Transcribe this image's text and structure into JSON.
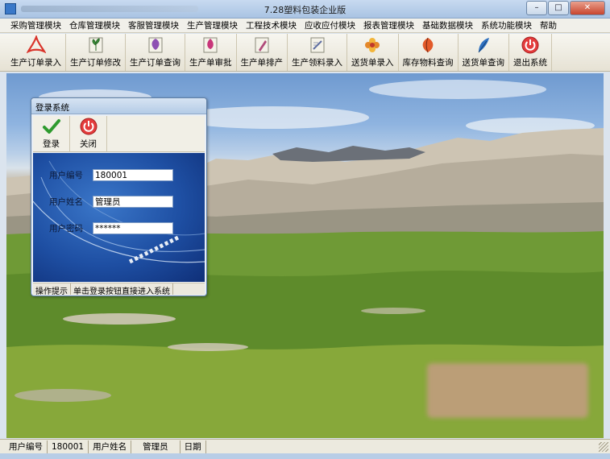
{
  "window": {
    "title": "7.28塑料包装企业版",
    "minimize": "–",
    "maximize": "□",
    "close": "✕"
  },
  "menu": [
    "采购管理模块",
    "仓库管理模块",
    "客服管理模块",
    "生产管理模块",
    "工程技术模块",
    "应收应付模块",
    "报表管理模块",
    "基础数据模块",
    "系统功能模块",
    "帮助"
  ],
  "toolbar": [
    {
      "label": "生产订单录入",
      "icon": "acrobat-icon",
      "color": "#d9342b"
    },
    {
      "label": "生产订单修改",
      "icon": "plant-icon",
      "color": "#3c8e3a"
    },
    {
      "label": "生产订单查询",
      "icon": "purple-flower-icon",
      "color": "#8e4fb3"
    },
    {
      "label": "生产单审批",
      "icon": "pink-flower-icon",
      "color": "#c8367a"
    },
    {
      "label": "生产单排产",
      "icon": "pen-icon",
      "color": "#b04b7a"
    },
    {
      "label": "生产领料录入",
      "icon": "document-pen-icon",
      "color": "#5f6fa3"
    },
    {
      "label": "送货单录入",
      "icon": "flower-icon",
      "color": "#e4882a"
    },
    {
      "label": "库存物料查询",
      "icon": "orange-flower-icon",
      "color": "#e25a2a"
    },
    {
      "label": "送货单查询",
      "icon": "blue-feather-icon",
      "color": "#2f71c0"
    },
    {
      "label": "退出系统",
      "icon": "exit-icon",
      "color": "#e33b3b"
    }
  ],
  "dialog": {
    "title": "登录系统",
    "login_label": "登录",
    "close_label": "关闭",
    "user_id_label": "用户编号",
    "user_id_value": "180001",
    "user_name_label": "用户姓名",
    "user_name_value": "管理员",
    "password_label": "用户密码",
    "password_value": "******",
    "hint_label": "操作提示",
    "hint_text": "单击登录按钮直接进入系统"
  },
  "statusbar": {
    "user_id_label": "用户编号",
    "user_id_value": "180001",
    "user_name_label": "用户姓名",
    "user_name_value": "管理员",
    "date_label": "日期"
  }
}
